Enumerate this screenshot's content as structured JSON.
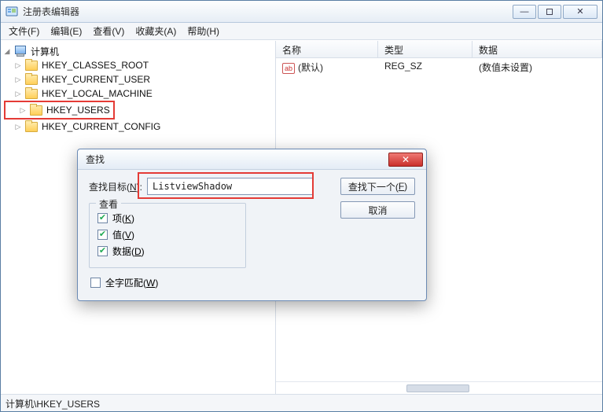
{
  "window": {
    "title": "注册表编辑器",
    "min_tip": "最小化",
    "max_tip": "最大化",
    "close_tip": "关闭"
  },
  "menu": {
    "file": "文件(F)",
    "edit": "编辑(E)",
    "view": "查看(V)",
    "favorites": "收藏夹(A)",
    "help": "帮助(H)"
  },
  "tree": {
    "root": "计算机",
    "items": [
      "HKEY_CLASSES_ROOT",
      "HKEY_CURRENT_USER",
      "HKEY_LOCAL_MACHINE",
      "HKEY_USERS",
      "HKEY_CURRENT_CONFIG"
    ],
    "selected_index": 3
  },
  "columns": {
    "name": "名称",
    "type": "类型",
    "data": "数据"
  },
  "value_row": {
    "name": "(默认)",
    "type": "REG_SZ",
    "data": "(数值未设置)"
  },
  "statusbar": {
    "path": "计算机\\HKEY_USERS"
  },
  "find_dialog": {
    "title": "查找",
    "target_label_pre": "查找目标(",
    "target_accel": "N",
    "target_label_post": "):",
    "target_value": "ListviewShadow",
    "btn_find_pre": "查找下一个(",
    "btn_find_accel": "F",
    "btn_find_post": ")",
    "btn_cancel": "取消",
    "group_legend": "查看",
    "opt_keys_pre": "项(",
    "opt_keys_accel": "K",
    "opt_keys_post": ")",
    "opt_values_pre": "值(",
    "opt_values_accel": "V",
    "opt_values_post": ")",
    "opt_data_pre": "数据(",
    "opt_data_accel": "D",
    "opt_data_post": ")",
    "whole_pre": "全字匹配(",
    "whole_accel": "W",
    "whole_post": ")",
    "opt_keys_checked": true,
    "opt_values_checked": true,
    "opt_data_checked": true,
    "whole_checked": false
  }
}
